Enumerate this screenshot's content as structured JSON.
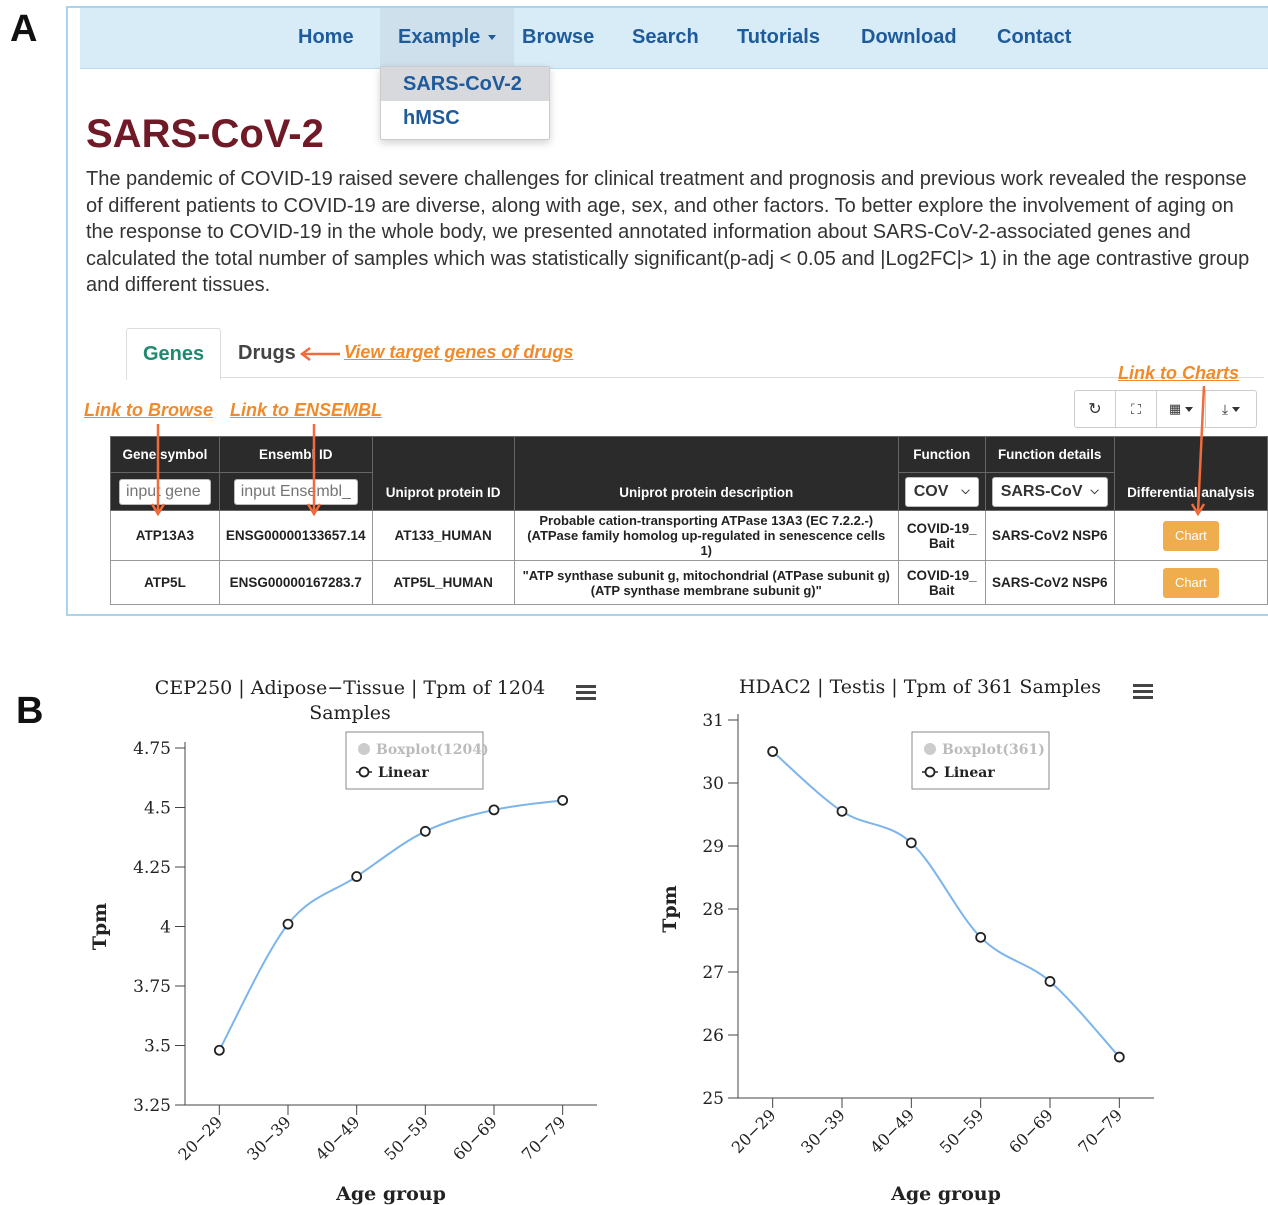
{
  "panels": {
    "a": "A",
    "b": "B"
  },
  "nav": {
    "items": [
      "Home",
      "Example",
      "Browse",
      "Search",
      "Tutorials",
      "Download",
      "Contact"
    ],
    "dropdown": [
      "SARS-CoV-2",
      "hMSC"
    ]
  },
  "page": {
    "title": "SARS-CoV-2",
    "intro": "The pandemic of COVID-19 raised severe challenges for clinical treatment and prognosis and previous work revealed the response of different patients to COVID-19 are diverse, along with age, sex, and other factors. To better explore the involvement of aging on the response to COVID-19 in the whole body, we presented annotated information about SARS-CoV-2-associated genes and calculated the total number of samples which was statistically significant(p-adj < 0.05 and |Log2FC|> 1) in the age contrastive group and different tissues."
  },
  "tabs": {
    "genes": "Genes",
    "drugs": "Drugs"
  },
  "annotations": {
    "drugs": "View target genes of drugs",
    "charts": "Link to Charts",
    "browse": "Link to Browse",
    "ensembl": "Link to ENSEMBL"
  },
  "table": {
    "headers": {
      "gene_symbol": "Gene symbol",
      "ensembl_id": "Ensembl ID",
      "uniprot_id": "Uniprot protein ID",
      "uniprot_desc": "Uniprot protein description",
      "function": "Function",
      "function_details": "Function details",
      "diff": "Differential analysis"
    },
    "filters": {
      "gene_placeholder": "input gene",
      "ensembl_placeholder": "input Ensembl_I",
      "function_value": "COV",
      "details_value": "SARS-CoV"
    },
    "rows": [
      {
        "gene": "ATP13A3",
        "ensembl": "ENSG00000133657.14",
        "uniprot": "AT133_HUMAN",
        "desc": "Probable cation-transporting ATPase 13A3 (EC 7.2.2.-) (ATPase family homolog up-regulated in senescence cells 1)",
        "function": "COVID-19_Bait",
        "details": "SARS-CoV2 NSP6",
        "button": "Chart"
      },
      {
        "gene": "ATP5L",
        "ensembl": "ENSG00000167283.7",
        "uniprot": "ATP5L_HUMAN",
        "desc": "\"ATP synthase subunit g, mitochondrial (ATPase subunit g) (ATP synthase membrane subunit g)\"",
        "function": "COVID-19_Bait",
        "details": "SARS-CoV2 NSP6",
        "button": "Chart"
      }
    ]
  },
  "chart_data": [
    {
      "type": "line",
      "title": "CEP250 | Adipose−Tissue | Tpm of 1204 Samples",
      "title_lines": [
        "CEP250 | Adipose−Tissue | Tpm of 1204",
        "Samples"
      ],
      "xlabel": "Age group",
      "ylabel": "Tpm",
      "categories": [
        "20−29",
        "30−39",
        "40−49",
        "50−59",
        "60−69",
        "70−79"
      ],
      "yticks": [
        "4.75",
        "4.5",
        "4.25",
        "4",
        "3.75",
        "3.5",
        "3.25"
      ],
      "ylim": [
        3.25,
        4.75
      ],
      "legend": [
        "Boxplot(1204)",
        "Linear"
      ],
      "series": [
        {
          "name": "Linear",
          "values": [
            3.48,
            4.01,
            4.21,
            4.4,
            4.49,
            4.53
          ]
        }
      ],
      "line_color": "#7cb5ec"
    },
    {
      "type": "line",
      "title": "HDAC2 | Testis | Tpm of 361 Samples",
      "title_lines": [
        "HDAC2 | Testis | Tpm of 361 Samples"
      ],
      "xlabel": "Age group",
      "ylabel": "Tpm",
      "categories": [
        "20−29",
        "30−39",
        "40−49",
        "50−59",
        "60−69",
        "70−79"
      ],
      "yticks": [
        "31",
        "30",
        "29",
        "28",
        "27",
        "26",
        "25"
      ],
      "ylim": [
        25,
        31
      ],
      "legend": [
        "Boxplot(361)",
        "Linear"
      ],
      "series": [
        {
          "name": "Linear",
          "values": [
            30.5,
            29.55,
            29.05,
            27.55,
            26.85,
            25.65
          ]
        }
      ],
      "line_color": "#7cb5ec"
    }
  ]
}
